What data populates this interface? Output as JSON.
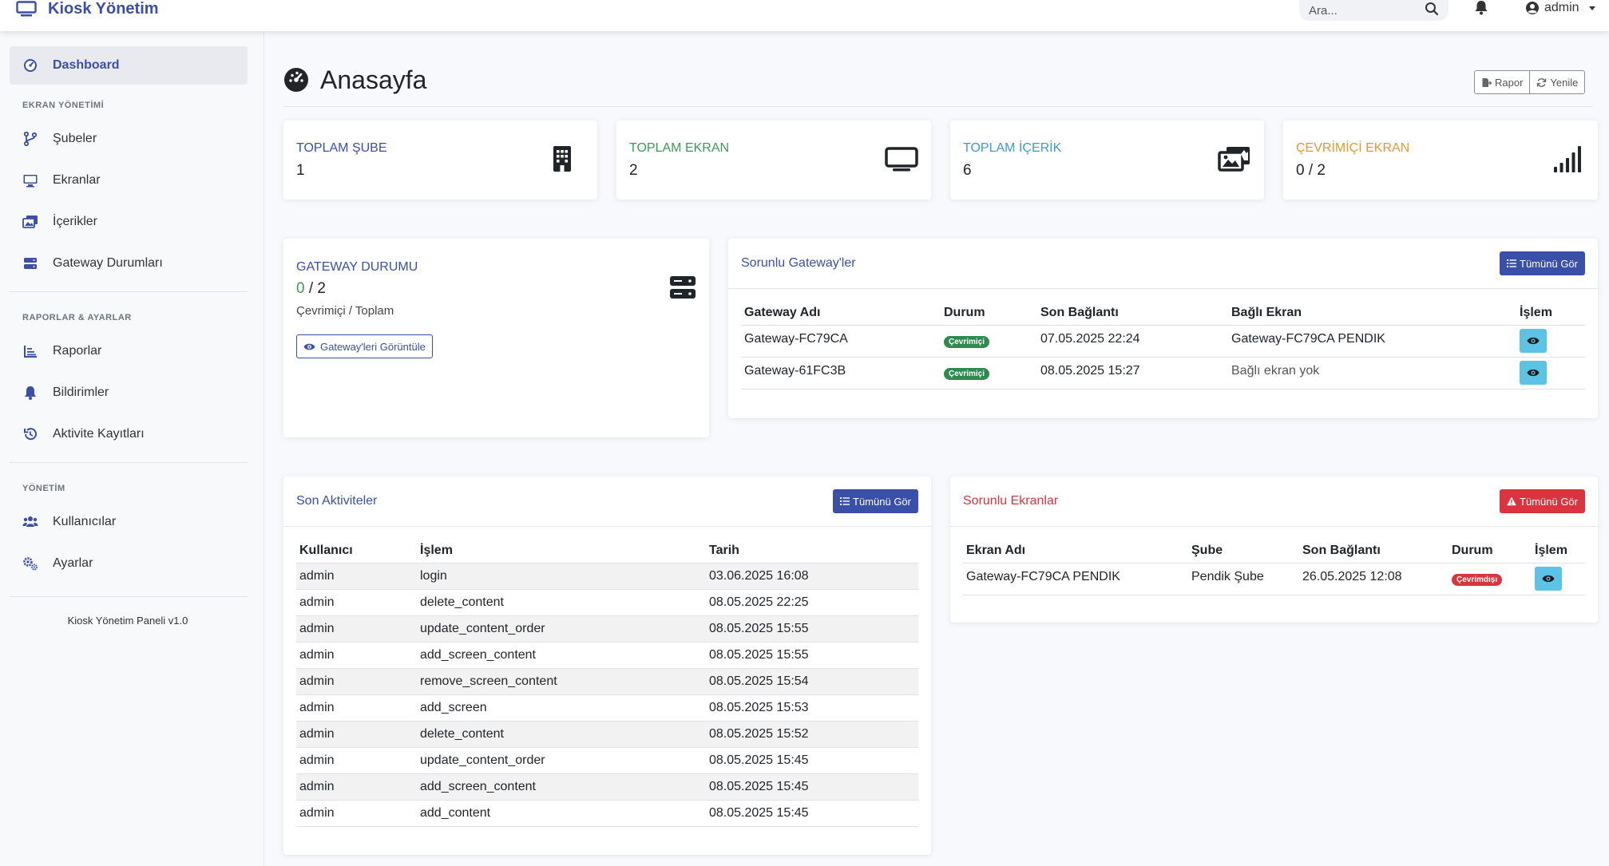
{
  "app": {
    "brand": "Kiosk Yönetim",
    "search_placeholder": "Ara...",
    "user": "admin"
  },
  "sidebar": {
    "dashboard": "Dashboard",
    "section_screen": "EKRAN YÖNETİMİ",
    "branches": "Şubeler",
    "screens": "Ekranlar",
    "contents": "İçerikler",
    "gateway_status": "Gateway Durumları",
    "section_reports": "RAPORLAR & AYARLAR",
    "reports": "Raporlar",
    "notifications": "Bildirimler",
    "activity_logs": "Aktivite Kayıtları",
    "section_admin": "YÖNETİM",
    "users": "Kullanıcılar",
    "settings": "Ayarlar",
    "footer": "Kiosk Yönetim Paneli v1.0"
  },
  "header": {
    "title": "Anasayfa",
    "report_button": "Rapor",
    "refresh_button": "Yenile"
  },
  "stats": {
    "branches": {
      "label": "TOPLAM ŞUBE",
      "value": "1",
      "color": "#3a4fa8"
    },
    "screens": {
      "label": "TOPLAM EKRAN",
      "value": "2",
      "color": "#3f9a5a"
    },
    "contents": {
      "label": "TOPLAM İÇERİK",
      "value": "6",
      "color": "#3c9bd4"
    },
    "online": {
      "label": "ÇEVRİMİÇİ EKRAN",
      "value": "0 / 2",
      "color": "#e69a2e"
    }
  },
  "gateway_card": {
    "title": "GATEWAY DURUMU",
    "online": "0",
    "total": "/ 2",
    "caption": "Çevrimiçi / Toplam",
    "button": "Gateway'leri Görüntüle"
  },
  "problem_gateways": {
    "title": "Sorunlu Gateway'ler",
    "view_all": "Tümünü Gör",
    "columns": [
      "Gateway Adı",
      "Durum",
      "Son Bağlantı",
      "Bağlı Ekran",
      "İşlem"
    ],
    "rows": [
      {
        "name": "Gateway-FC79CA",
        "status": "Çevrimiçi",
        "last": "07.05.2025 22:24",
        "screen": "Gateway-FC79CA PENDIK"
      },
      {
        "name": "Gateway-61FC3B",
        "status": "Çevrimiçi",
        "last": "08.05.2025 15:27",
        "screen": "Bağlı ekran yok"
      }
    ]
  },
  "recent_activities": {
    "title": "Son Aktiviteler",
    "view_all": "Tümünü Gör",
    "columns": [
      "Kullanıcı",
      "İşlem",
      "Tarih"
    ],
    "rows": [
      {
        "user": "admin",
        "action": "login",
        "date": "03.06.2025 16:08"
      },
      {
        "user": "admin",
        "action": "delete_content",
        "date": "08.05.2025 22:25"
      },
      {
        "user": "admin",
        "action": "update_content_order",
        "date": "08.05.2025 15:55"
      },
      {
        "user": "admin",
        "action": "add_screen_content",
        "date": "08.05.2025 15:55"
      },
      {
        "user": "admin",
        "action": "remove_screen_content",
        "date": "08.05.2025 15:54"
      },
      {
        "user": "admin",
        "action": "add_screen",
        "date": "08.05.2025 15:53"
      },
      {
        "user": "admin",
        "action": "delete_content",
        "date": "08.05.2025 15:52"
      },
      {
        "user": "admin",
        "action": "update_content_order",
        "date": "08.05.2025 15:45"
      },
      {
        "user": "admin",
        "action": "add_screen_content",
        "date": "08.05.2025 15:45"
      },
      {
        "user": "admin",
        "action": "add_content",
        "date": "08.05.2025 15:45"
      }
    ]
  },
  "problem_screens": {
    "title": "Sorunlu Ekranlar",
    "view_all": "Tümünü Gör",
    "columns": [
      "Ekran Adı",
      "Şube",
      "Son Bağlantı",
      "Durum",
      "İşlem"
    ],
    "rows": [
      {
        "name": "Gateway-FC79CA PENDIK",
        "branch": "Pendik Şube",
        "last": "26.05.2025 12:08",
        "status": "Çevrimdışı"
      }
    ]
  },
  "colors": {
    "primary": "#3a4fa8",
    "danger": "#d9343f",
    "info": "#5bc4e6",
    "success": "#2e8b4e"
  }
}
